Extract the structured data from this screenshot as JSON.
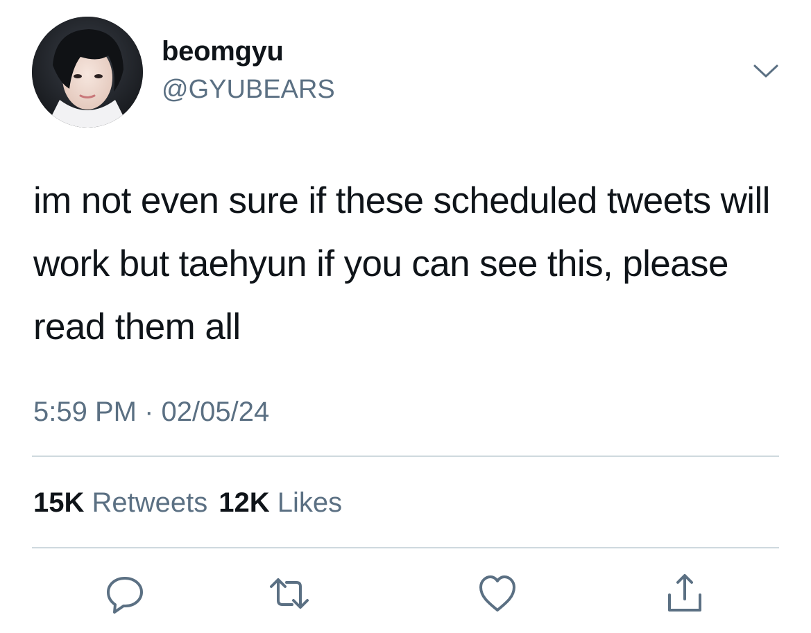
{
  "author": {
    "display_name": "beomgyu",
    "handle": "@GYUBEARS",
    "avatar_icon": "profile-photo"
  },
  "tweet": {
    "text": "im not even sure if these scheduled tweets will work but taehyun if you can see this, please read them all",
    "time": "5:59 PM",
    "separator": "·",
    "date": "02/05/24"
  },
  "stats": {
    "retweets_count": "15K",
    "retweets_label": "Retweets",
    "likes_count": "12K",
    "likes_label": "Likes"
  },
  "actions": {
    "reply_icon": "speech-bubble-icon",
    "retweet_icon": "retweet-arrows-icon",
    "like_icon": "heart-icon",
    "share_icon": "share-upload-icon",
    "more_icon": "chevron-down-icon"
  },
  "colors": {
    "primary_text": "#0f1419",
    "secondary_text": "#5b7083",
    "divider": "#cfd9de",
    "icon": "#5b7083"
  }
}
